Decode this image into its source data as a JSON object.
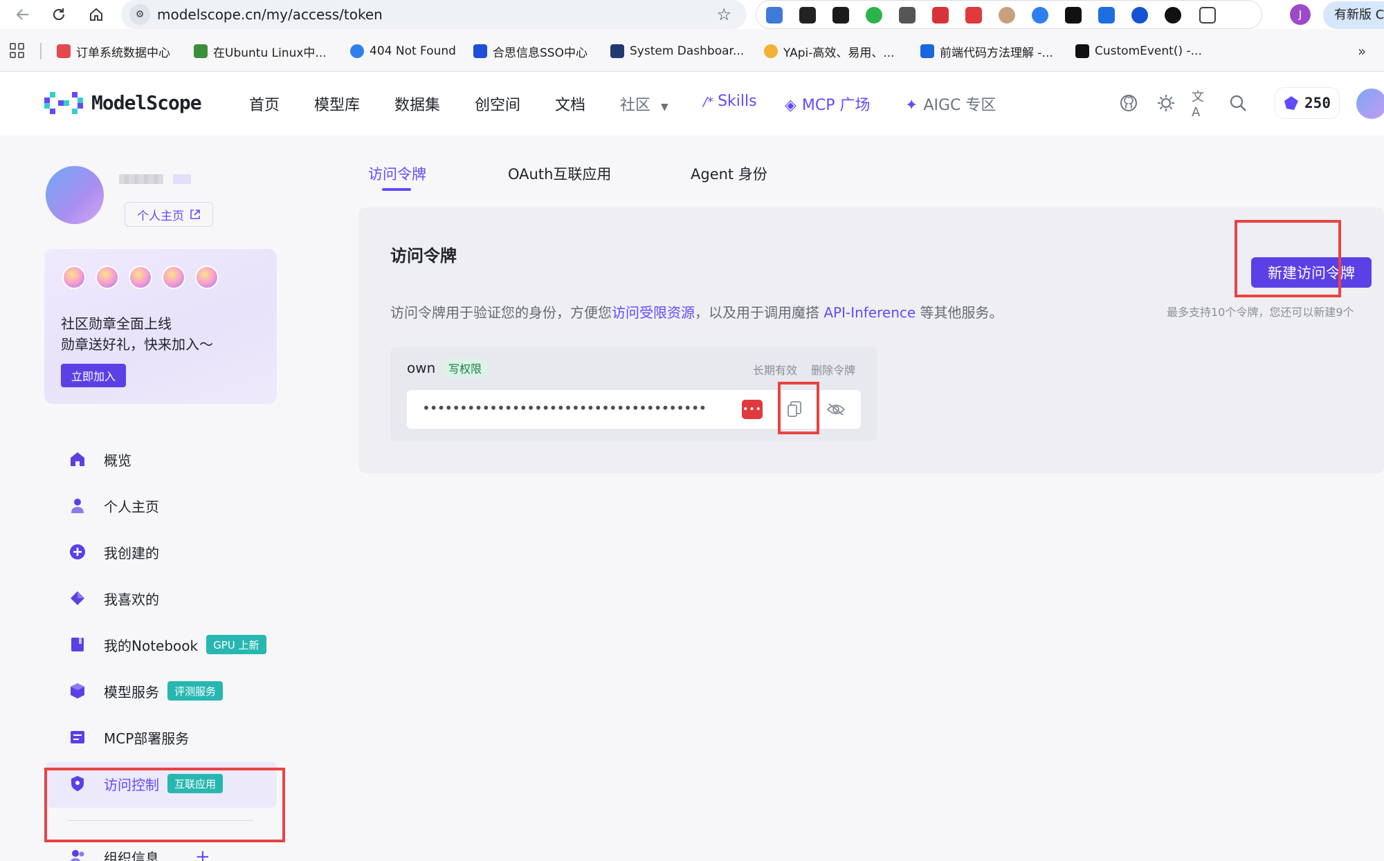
{
  "browser": {
    "url": "modelscope.cn/my/access/token",
    "profile_initial": "J",
    "update_label": "有新版 C",
    "bookmarks": [
      "订单系统数据中心",
      "在Ubuntu Linux中...",
      "404 Not Found",
      "合思信息SSO中心",
      "System Dashboar...",
      "YApi-高效、易用、...",
      "前端代码方法理解 -...",
      "CustomEvent() -..."
    ]
  },
  "header": {
    "logo_text": "ModelScope",
    "nav": [
      "首页",
      "模型库",
      "数据集",
      "创空间",
      "文档",
      "社区"
    ],
    "nav_special": [
      "Skills",
      "MCP 广场",
      "AIGC 专区"
    ],
    "points": "250",
    "brand_color": "#624aff"
  },
  "sidebar": {
    "homepage_label": "个人主页",
    "banner": {
      "line1": "社区勋章全面上线",
      "line2": "勋章送好礼，快来加入～",
      "button": "立即加入"
    },
    "items": [
      {
        "label": "概览",
        "icon": "home-icon"
      },
      {
        "label": "个人主页",
        "icon": "user-icon"
      },
      {
        "label": "我创建的",
        "icon": "plus-circle-icon"
      },
      {
        "label": "我喜欢的",
        "icon": "diamond-icon"
      },
      {
        "label": "我的Notebook",
        "icon": "notebook-icon",
        "tag": "GPU 上新"
      },
      {
        "label": "模型服务",
        "icon": "cube-icon",
        "tag": "评测服务"
      },
      {
        "label": "MCP部署服务",
        "icon": "server-icon"
      },
      {
        "label": "访问控制",
        "icon": "shield-icon",
        "tag": "互联应用",
        "active": true
      },
      {
        "label": "组织信息",
        "icon": "group-icon"
      }
    ]
  },
  "main": {
    "tabs": [
      "访问令牌",
      "OAuth互联应用",
      "Agent 身份"
    ],
    "panel": {
      "title": "访问令牌",
      "desc_before": "访问令牌用于验证您的身份，方便您",
      "desc_link1": "访问受限资源",
      "desc_mid": "，以及用于调用魔搭 ",
      "desc_link2": "API-Inference",
      "desc_after": " 等其他服务。",
      "create_button": "新建访问令牌",
      "limit_text": "最多支持10个令牌，您还可以新建9个"
    },
    "token": {
      "name": "own",
      "permission": "写权限",
      "validity": "长期有效",
      "delete_label": "删除令牌",
      "masked_value": "••••••••••••••••••••••••••••••••••••••",
      "password_manager_label": "•••"
    }
  }
}
